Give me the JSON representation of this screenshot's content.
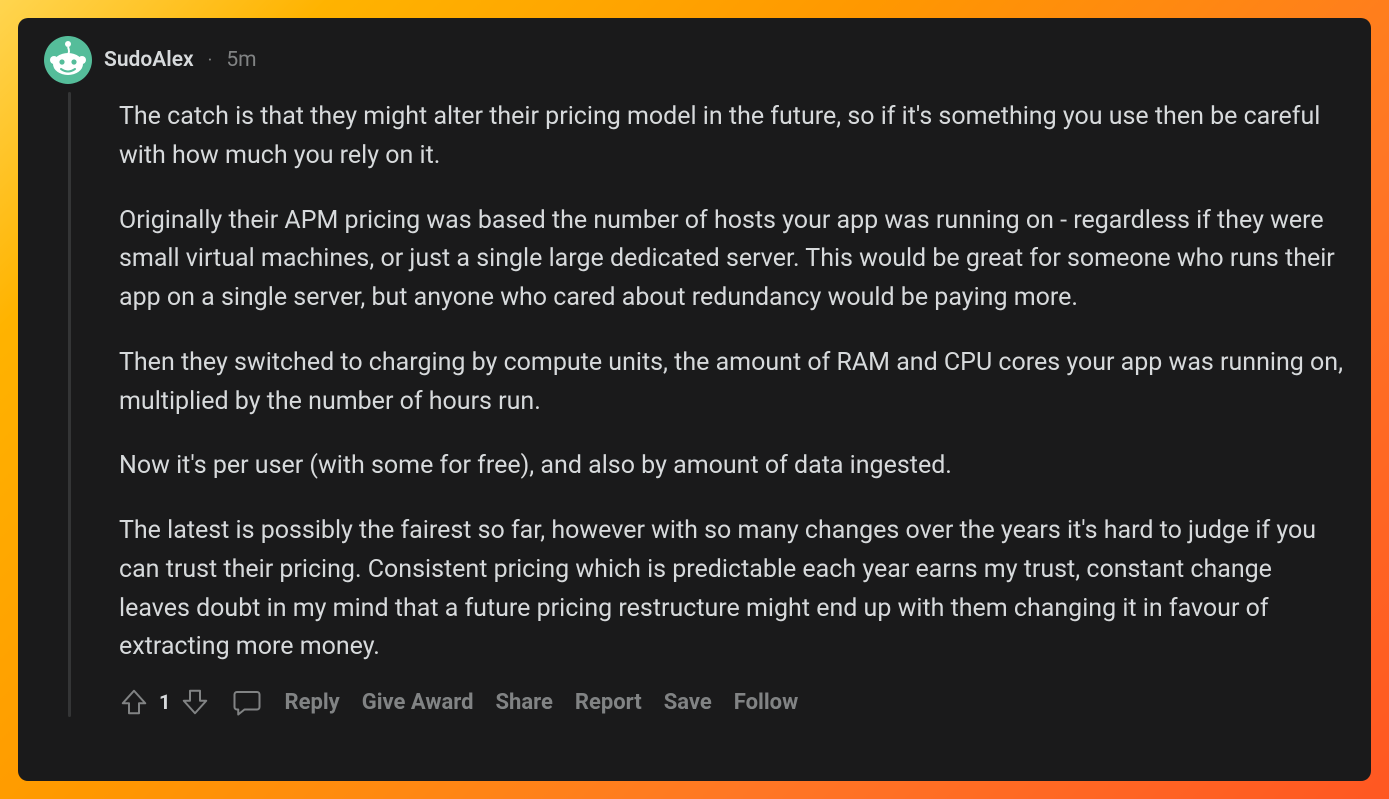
{
  "header": {
    "username": "SudoAlex",
    "separator": "·",
    "timestamp": "5m"
  },
  "body": {
    "p1": "The catch is that they might alter their pricing model in the future, so if it's something you use then be careful with how much you rely on it.",
    "p2": "Originally their APM pricing was based the number of hosts your app was running on - regardless if they were small virtual machines, or just a single large dedicated server. This would be great for someone who runs their app on a single server, but anyone who cared about redundancy would be paying more.",
    "p3": "Then they switched to charging by compute units, the amount of RAM and CPU cores your app was running on, multiplied by the number of hours run.",
    "p4": "Now it's per user (with some for free), and also by amount of data ingested.",
    "p5": "The latest is possibly the fairest so far, however with so many changes over the years it's hard to judge if you can trust their pricing. Consistent pricing which is predictable each year earns my trust, constant change leaves doubt in my mind that a future pricing restructure might end up with them changing it in favour of extracting more money."
  },
  "actions": {
    "score": "1",
    "reply": "Reply",
    "award": "Give Award",
    "share": "Share",
    "report": "Report",
    "save": "Save",
    "follow": "Follow"
  }
}
